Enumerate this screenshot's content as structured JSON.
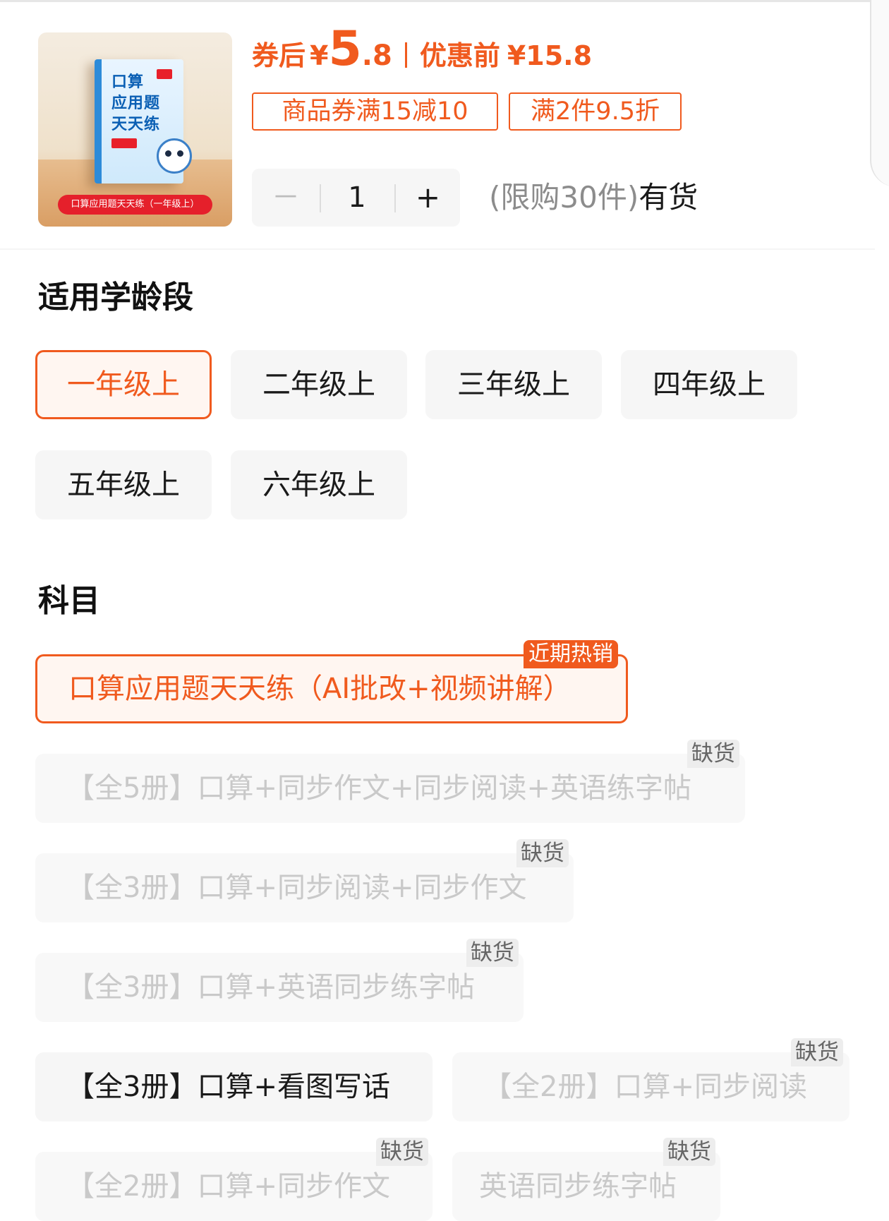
{
  "product": {
    "image_title_lines": [
      "口算",
      "应用题",
      "天天练"
    ],
    "image_banner": "口算应用题天天练（一年级上）"
  },
  "price": {
    "after_coupon_label": "券后",
    "currency": "¥",
    "after_coupon_integer": "5",
    "after_coupon_decimal": ".8",
    "before_label": "优惠前",
    "before_value": "¥15.8",
    "accent_color": "#f05a1e"
  },
  "coupons": [
    "商品券满15减10",
    "满2件9.5折"
  ],
  "quantity": {
    "minus": "－",
    "value": "1",
    "plus": "+",
    "limit_text": "(限购30件)",
    "stock_text": "有货"
  },
  "age_section": {
    "title": "适用学龄段",
    "options": [
      {
        "label": "一年级上",
        "selected": true
      },
      {
        "label": "二年级上",
        "selected": false
      },
      {
        "label": "三年级上",
        "selected": false
      },
      {
        "label": "四年级上",
        "selected": false
      },
      {
        "label": "五年级上",
        "selected": false
      },
      {
        "label": "六年级上",
        "selected": false
      }
    ]
  },
  "subject_section": {
    "title": "科目",
    "options": [
      {
        "label": "口算应用题天天练（AI批改+视频讲解）",
        "badge": "近期热销",
        "state": "selected"
      },
      {
        "label": "【全5册】口算+同步作文+同步阅读+英语练字帖",
        "badge": "缺货",
        "state": "out_of_stock"
      },
      {
        "label": "【全3册】口算+同步阅读+同步作文",
        "badge": "缺货",
        "state": "out_of_stock"
      },
      {
        "label": "【全3册】口算+英语同步练字帖",
        "badge": "缺货",
        "state": "out_of_stock"
      },
      {
        "label": "【全3册】口算+看图写话",
        "badge": "",
        "state": "available"
      },
      {
        "label": "【全2册】口算+同步阅读",
        "badge": "缺货",
        "state": "out_of_stock"
      },
      {
        "label": "【全2册】口算+同步作文",
        "badge": "缺货",
        "state": "out_of_stock"
      },
      {
        "label": "英语同步练字帖",
        "badge": "缺货",
        "state": "out_of_stock"
      }
    ]
  }
}
